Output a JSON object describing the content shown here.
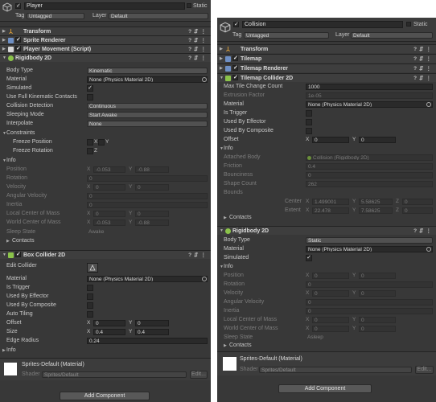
{
  "left": {
    "name": "Player",
    "static_label": "Static",
    "tag_label": "Tag",
    "tag_value": "Untagged",
    "layer_label": "Layer",
    "layer_value": "Default",
    "components": [
      "Transform",
      "Sprite Renderer",
      "Player Movement (Script)",
      "Rigidbody 2D",
      "Box Collider 2D"
    ],
    "rigidbody": {
      "body_type": [
        "Body Type",
        "Kinematic"
      ],
      "material": [
        "Material",
        "None (Physics Material 2D)"
      ],
      "simulated": "Simulated",
      "full_contacts": "Use Full Kinematic Contacts",
      "collision": [
        "Collision Detection",
        "Continuous"
      ],
      "sleeping": [
        "Sleeping Mode",
        "Start Awake"
      ],
      "interpolate": [
        "Interpolate",
        "None"
      ],
      "constraints": "Constraints",
      "freeze_pos": "Freeze Position",
      "freeze_rot": "Freeze Rotation",
      "x": "X",
      "y": "Y",
      "z": "Z",
      "info": "Info",
      "position": [
        "Position",
        "X",
        "-0.053",
        "Y",
        "-0.88"
      ],
      "rotation": [
        "Rotation",
        "0"
      ],
      "velocity": [
        "Velocity",
        "X",
        "0",
        "Y",
        "0"
      ],
      "angular": [
        "Angular Velocity",
        "0"
      ],
      "inertia": [
        "Inertia",
        "0"
      ],
      "local_com": [
        "Local Center of Mass",
        "X",
        "0",
        "Y",
        "0"
      ],
      "world_com": [
        "World Center of Mass",
        "X",
        "-0.053",
        "Y",
        "-0.88"
      ],
      "sleep_state": [
        "Sleep State",
        "Awake"
      ],
      "contacts": "Contacts"
    },
    "box": {
      "edit_collider": "Edit Collider",
      "material": [
        "Material",
        "None (Physics Material 2D)"
      ],
      "is_trigger": "Is Trigger",
      "used_effector": "Used By Effector",
      "used_composite": "Used By Composite",
      "auto_tiling": "Auto Tiling",
      "offset": [
        "Offset",
        "X",
        "0",
        "Y",
        "0"
      ],
      "size": [
        "Size",
        "X",
        "0.4",
        "Y",
        "0.4"
      ],
      "edge_radius": [
        "Edge Radius",
        "0.24"
      ],
      "info": "Info"
    },
    "mat": {
      "name": "Sprites-Default (Material)",
      "shader_label": "Shader",
      "shader_value": "Sprites/Default",
      "edit": "Edit..."
    },
    "add_component": "Add Component"
  },
  "right": {
    "name": "Collision",
    "static_label": "Static",
    "tag_label": "Tag",
    "tag_value": "Untagged",
    "layer_label": "Layer",
    "layer_value": "Default",
    "components": [
      "Transform",
      "Tilemap",
      "Tilemap Renderer",
      "Tilemap Collider 2D",
      "Rigidbody 2D"
    ],
    "tilemap_collider": {
      "max_tile": [
        "Max Tile Change Count",
        "1000"
      ],
      "extrusion": [
        "Extrusion Factor",
        "1e-05"
      ],
      "material": [
        "Material",
        "None (Physics Material 2D)"
      ],
      "is_trigger": "Is Trigger",
      "used_effector": "Used By Effector",
      "used_composite": "Used By Composite",
      "offset": [
        "Offset",
        "X",
        "0",
        "Y",
        "0"
      ],
      "info": "Info",
      "attached": [
        "Attached Body",
        "Collision (Rigidbody 2D)"
      ],
      "friction": [
        "Friction",
        "0.4"
      ],
      "bounciness": [
        "Bounciness",
        "0"
      ],
      "shape_count": [
        "Shape Count",
        "262"
      ],
      "bounds": "Bounds",
      "center": [
        "Center",
        "X",
        "1.499001",
        "Y",
        "5.58625",
        "Z",
        "0"
      ],
      "extent": [
        "Extent",
        "X",
        "22.478",
        "Y",
        "7.58625",
        "Z",
        "0"
      ],
      "contacts": "Contacts"
    },
    "rigidbody": {
      "body_type": [
        "Body Type",
        "Static"
      ],
      "material": [
        "Material",
        "None (Physics Material 2D)"
      ],
      "simulated": "Simulated",
      "info": "Info",
      "position": [
        "Position",
        "X",
        "0",
        "Y",
        "0"
      ],
      "rotation": [
        "Rotation",
        "0"
      ],
      "velocity": [
        "Velocity",
        "X",
        "0",
        "Y",
        "0"
      ],
      "angular": [
        "Angular Velocity",
        "0"
      ],
      "inertia": [
        "Inertia",
        "0"
      ],
      "local_com": [
        "Local Center of Mass",
        "X",
        "0",
        "Y",
        "0"
      ],
      "world_com": [
        "World Center of Mass",
        "X",
        "0",
        "Y",
        "0"
      ],
      "sleep_state": [
        "Sleep State",
        "Asleep"
      ],
      "contacts": "Contacts"
    },
    "mat": {
      "name": "Sprites-Default (Material)",
      "shader_label": "Shader",
      "shader_value": "Sprites/Default",
      "edit": "Edit..."
    },
    "add_component": "Add Component"
  },
  "icons": {
    "check": "✓",
    "fold_open": "▼",
    "fold_closed": "▶"
  }
}
